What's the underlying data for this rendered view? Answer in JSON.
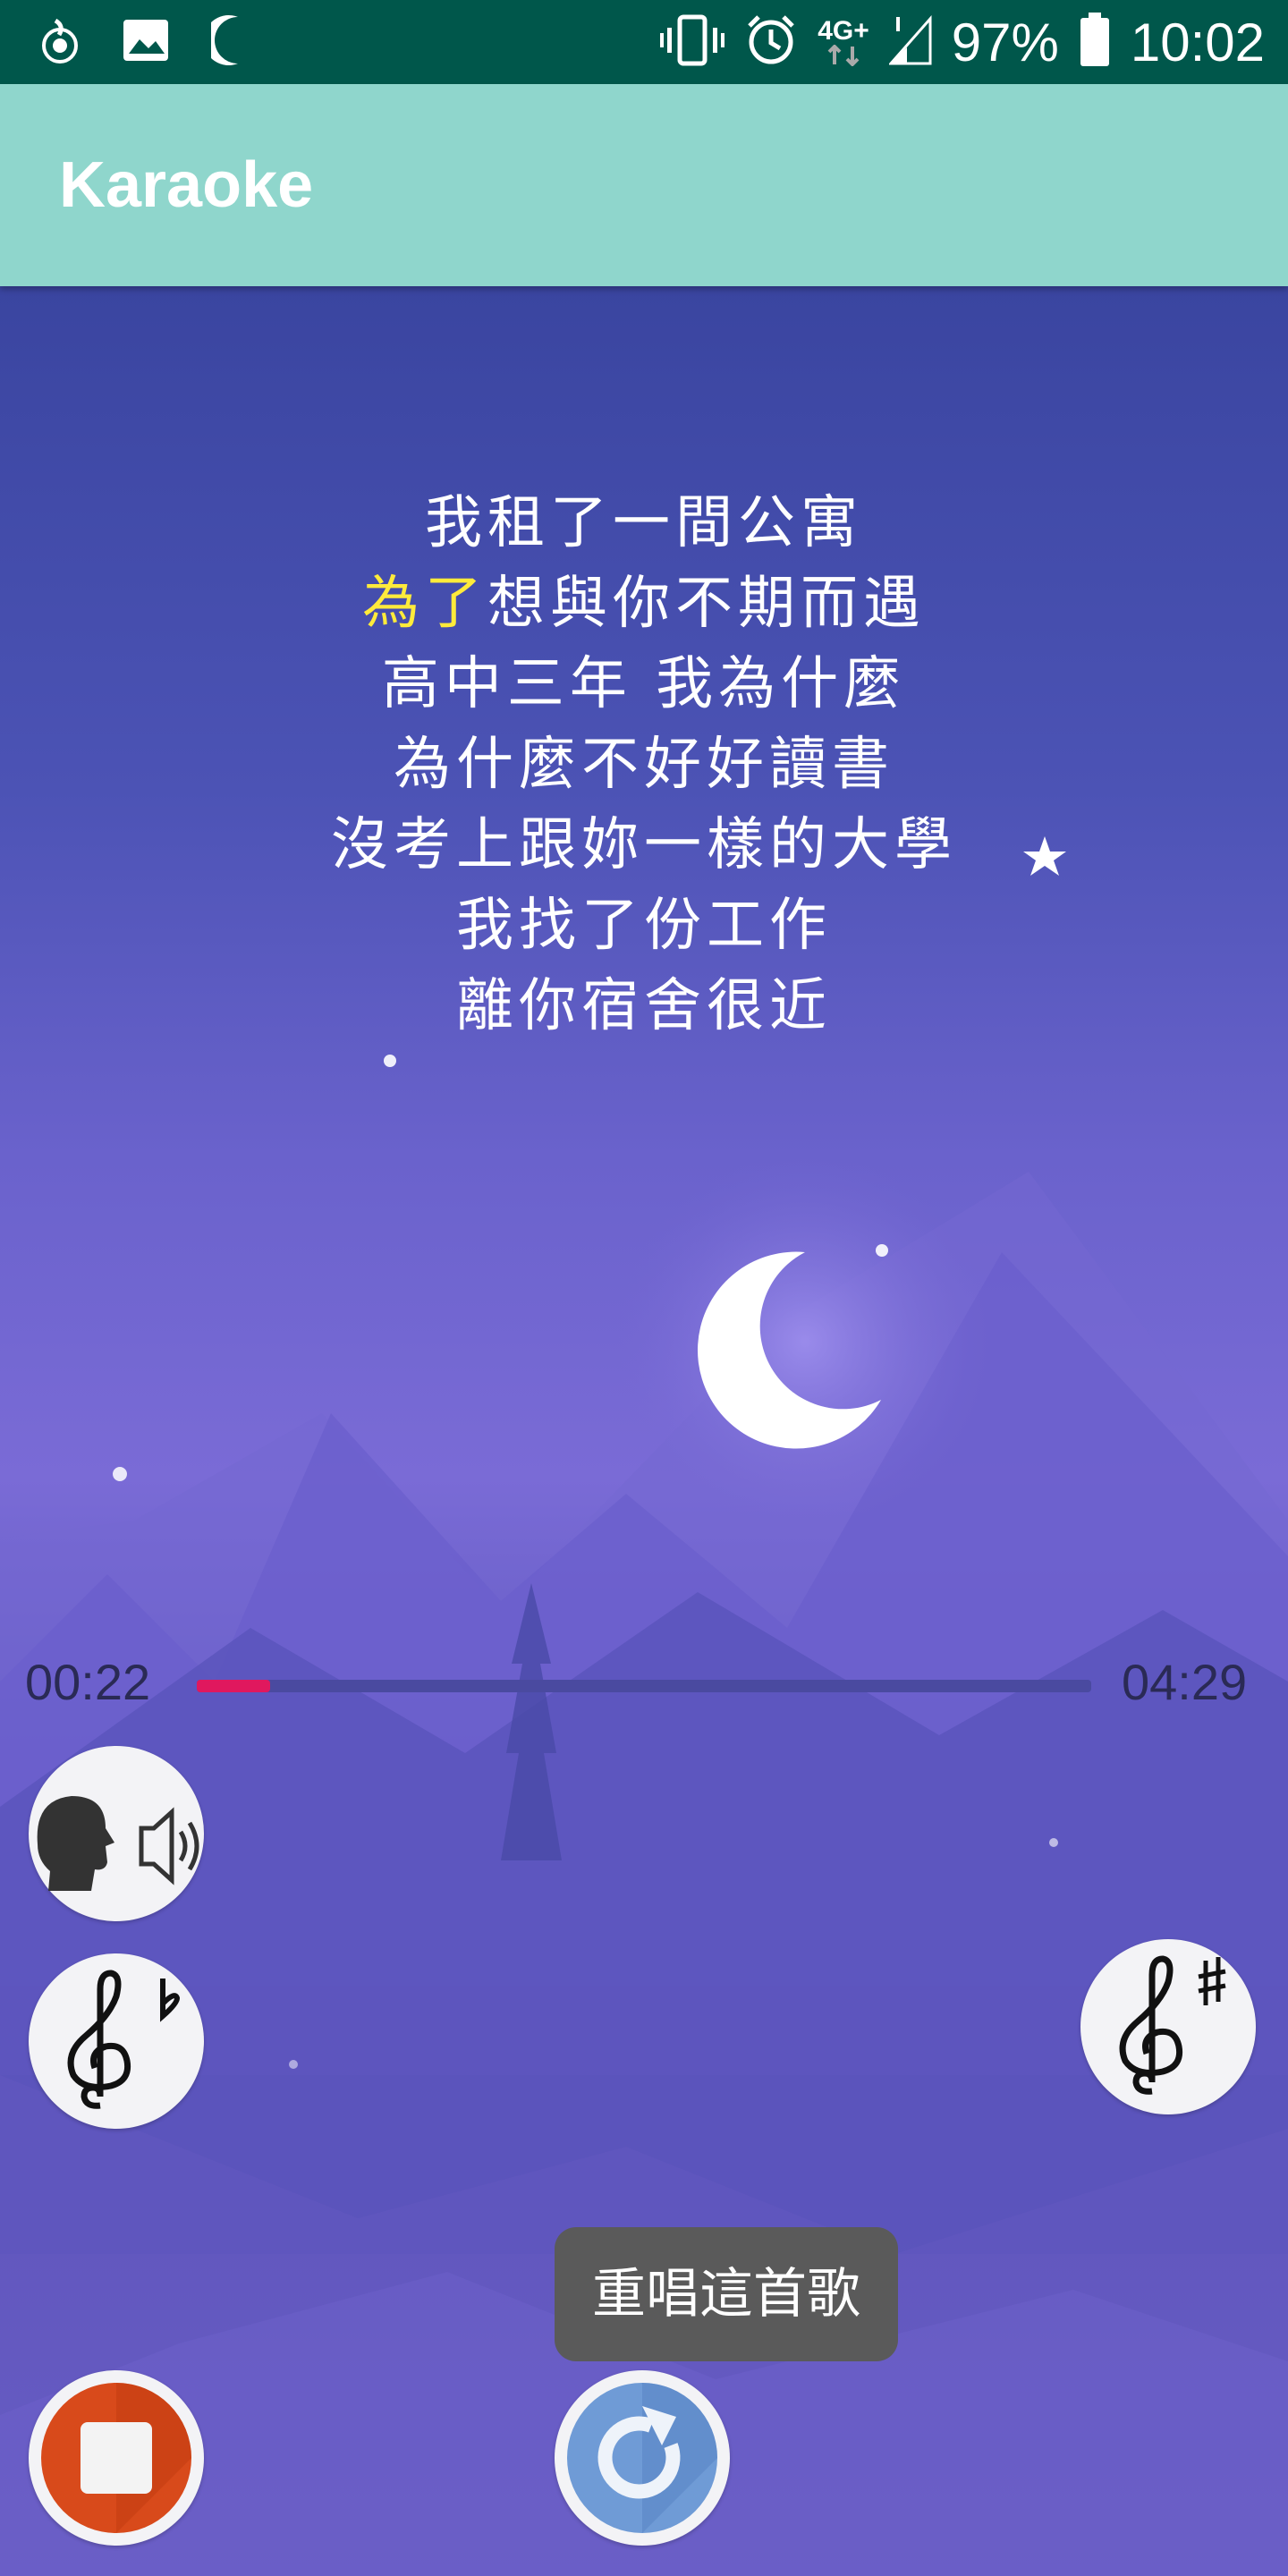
{
  "status_bar": {
    "lte_label": "4G+",
    "battery_percent": "97%",
    "time": "10:02",
    "icons": [
      "app-notification-icon",
      "image-icon",
      "moon-icon",
      "vibrate-icon",
      "alarm-icon",
      "signal-icon",
      "battery-icon"
    ]
  },
  "app_bar": {
    "title": "Karaoke"
  },
  "lyrics": {
    "line1": "我租了一間公寓",
    "line2_highlight": "為了",
    "line2_rest": "想與你不期而遇",
    "line3": "高中三年 我為什麼",
    "line4": "為什麼不好好讀書",
    "line5": "沒考上跟妳一樣的大學",
    "line6": "我找了份工作",
    "line7": "離你宿舍很近"
  },
  "player": {
    "current_time": "00:22",
    "total_time": "04:29",
    "progress_fraction": 0.082
  },
  "controls": {
    "vocal_toggle_icon": "vocal-speaker-icon",
    "pitch_down_icon": "treble-clef-flat-icon",
    "pitch_up_icon": "treble-clef-sharp-icon",
    "stop_icon": "stop-icon",
    "replay_icon": "replay-icon"
  },
  "toast": {
    "text": "重唱這首歌"
  },
  "colors": {
    "status_bar": "#00574b",
    "app_bar": "#8fd6cc",
    "highlight": "#ffeb3b",
    "progress": "#e0185e"
  }
}
